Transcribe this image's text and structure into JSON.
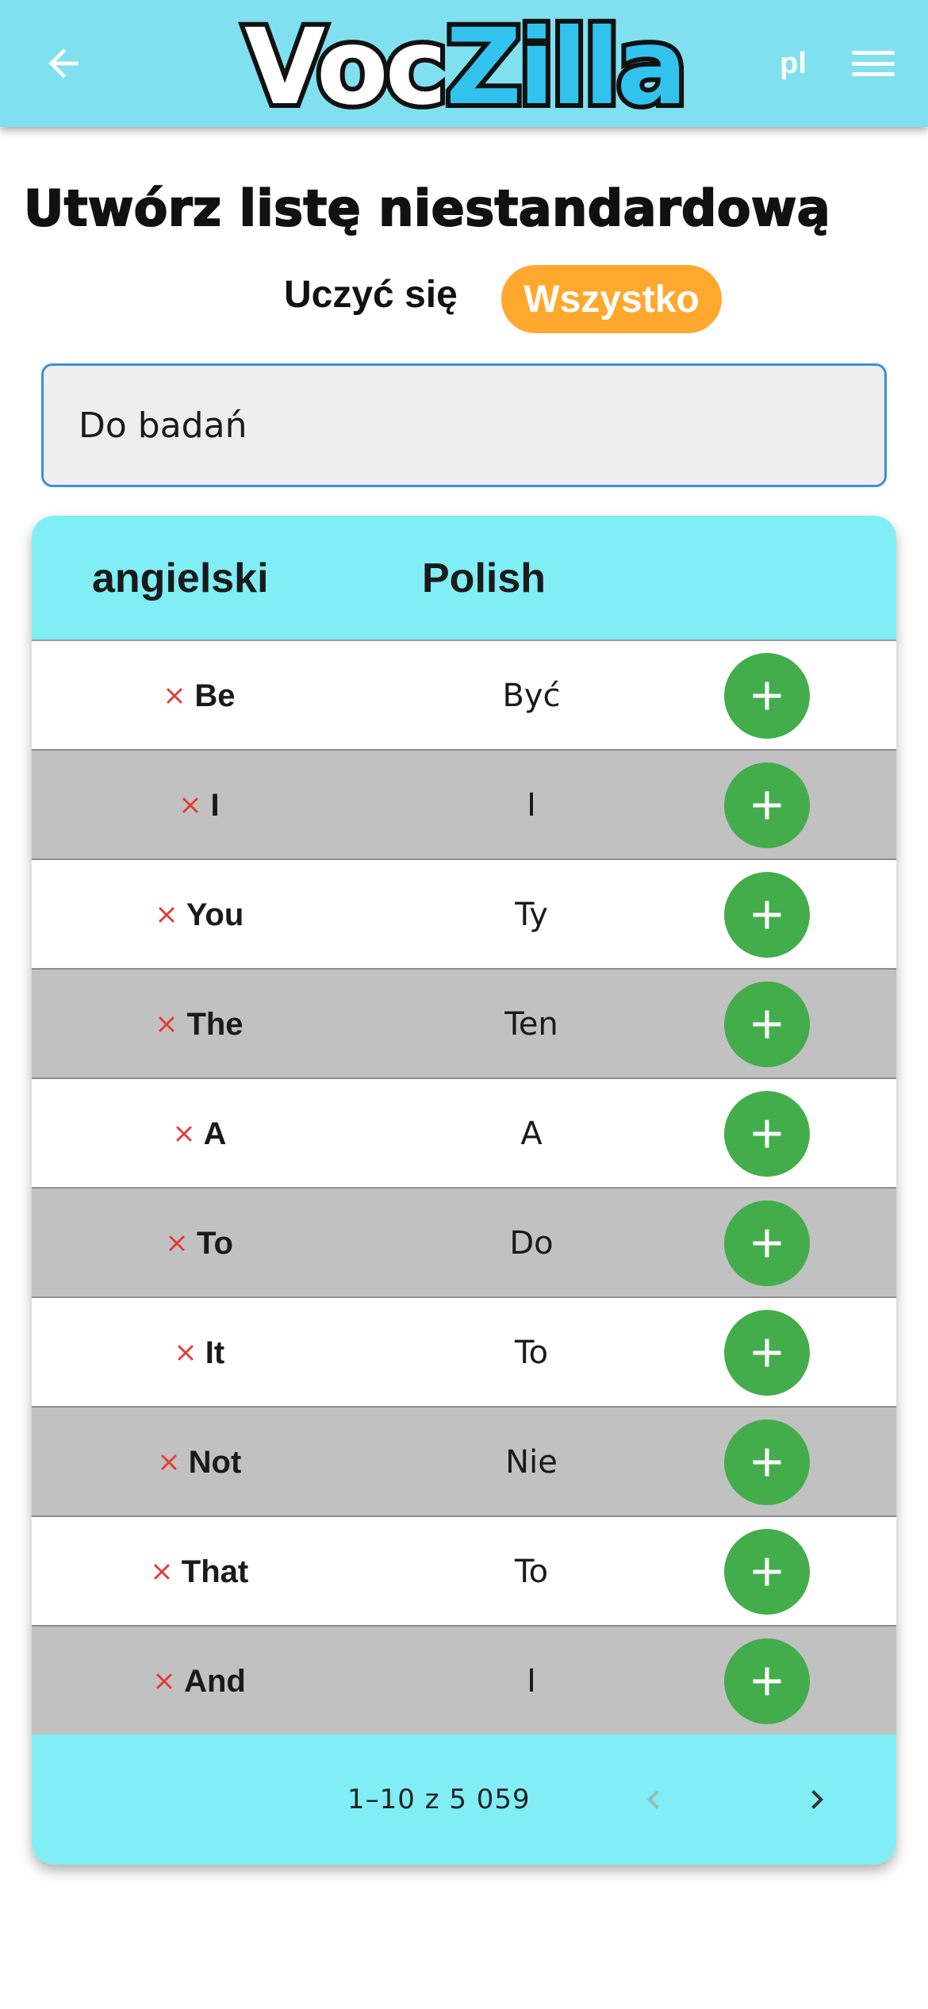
{
  "header": {
    "logo_part1": "Voc",
    "logo_part2": "Zilla",
    "language": "pl",
    "colors": {
      "bar": "#7fe0ef",
      "logo_accent": "#31c3ee"
    }
  },
  "page": {
    "title": "Utwórz listę niestandardową"
  },
  "toggle": {
    "learn_label": "Uczyć się",
    "all_label": "Wszystko",
    "active_color": "#ffa82e"
  },
  "list_name_input": {
    "value": "Do badań"
  },
  "table": {
    "col_source": "angielski",
    "col_target": "Polish",
    "rows": [
      {
        "en": "Be",
        "pl": "Być"
      },
      {
        "en": "I",
        "pl": "I"
      },
      {
        "en": "You",
        "pl": "Ty"
      },
      {
        "en": "The",
        "pl": "Ten"
      },
      {
        "en": "A",
        "pl": "A"
      },
      {
        "en": "To",
        "pl": "Do"
      },
      {
        "en": "It",
        "pl": "To"
      },
      {
        "en": "Not",
        "pl": "Nie"
      },
      {
        "en": "That",
        "pl": "To"
      },
      {
        "en": "And",
        "pl": "I"
      }
    ],
    "add_button_color": "#43ad4b",
    "remove_icon_color": "#e53935"
  },
  "pagination": {
    "range_text": "1–10 z 5 059"
  }
}
